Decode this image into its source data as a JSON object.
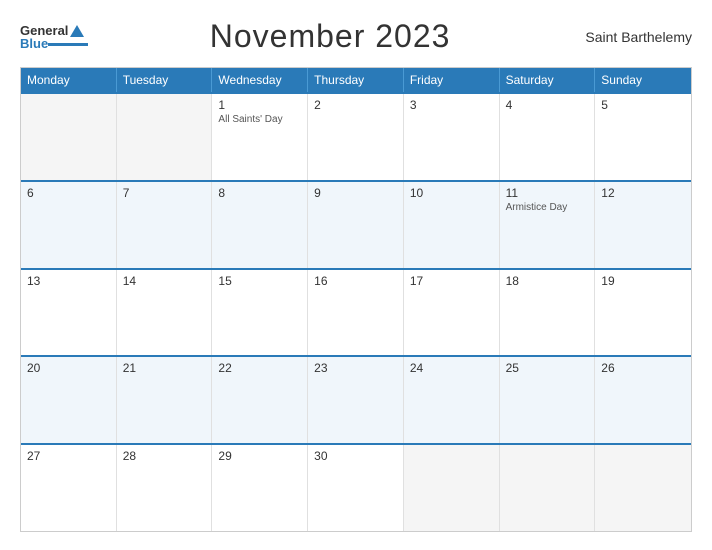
{
  "header": {
    "title": "November 2023",
    "region": "Saint Barthelemy",
    "logo": {
      "general": "General",
      "blue": "Blue"
    }
  },
  "calendar": {
    "weekdays": [
      "Monday",
      "Tuesday",
      "Wednesday",
      "Thursday",
      "Friday",
      "Saturday",
      "Sunday"
    ],
    "weeks": [
      [
        {
          "day": "",
          "empty": true
        },
        {
          "day": "",
          "empty": true
        },
        {
          "day": "1",
          "event": "All Saints' Day"
        },
        {
          "day": "2",
          "event": ""
        },
        {
          "day": "3",
          "event": ""
        },
        {
          "day": "4",
          "event": ""
        },
        {
          "day": "5",
          "event": ""
        }
      ],
      [
        {
          "day": "6",
          "event": ""
        },
        {
          "day": "7",
          "event": ""
        },
        {
          "day": "8",
          "event": ""
        },
        {
          "day": "9",
          "event": ""
        },
        {
          "day": "10",
          "event": ""
        },
        {
          "day": "11",
          "event": "Armistice Day"
        },
        {
          "day": "12",
          "event": ""
        }
      ],
      [
        {
          "day": "13",
          "event": ""
        },
        {
          "day": "14",
          "event": ""
        },
        {
          "day": "15",
          "event": ""
        },
        {
          "day": "16",
          "event": ""
        },
        {
          "day": "17",
          "event": ""
        },
        {
          "day": "18",
          "event": ""
        },
        {
          "day": "19",
          "event": ""
        }
      ],
      [
        {
          "day": "20",
          "event": ""
        },
        {
          "day": "21",
          "event": ""
        },
        {
          "day": "22",
          "event": ""
        },
        {
          "day": "23",
          "event": ""
        },
        {
          "day": "24",
          "event": ""
        },
        {
          "day": "25",
          "event": ""
        },
        {
          "day": "26",
          "event": ""
        }
      ],
      [
        {
          "day": "27",
          "event": ""
        },
        {
          "day": "28",
          "event": ""
        },
        {
          "day": "29",
          "event": ""
        },
        {
          "day": "30",
          "event": ""
        },
        {
          "day": "",
          "empty": true
        },
        {
          "day": "",
          "empty": true
        },
        {
          "day": "",
          "empty": true
        }
      ]
    ]
  }
}
